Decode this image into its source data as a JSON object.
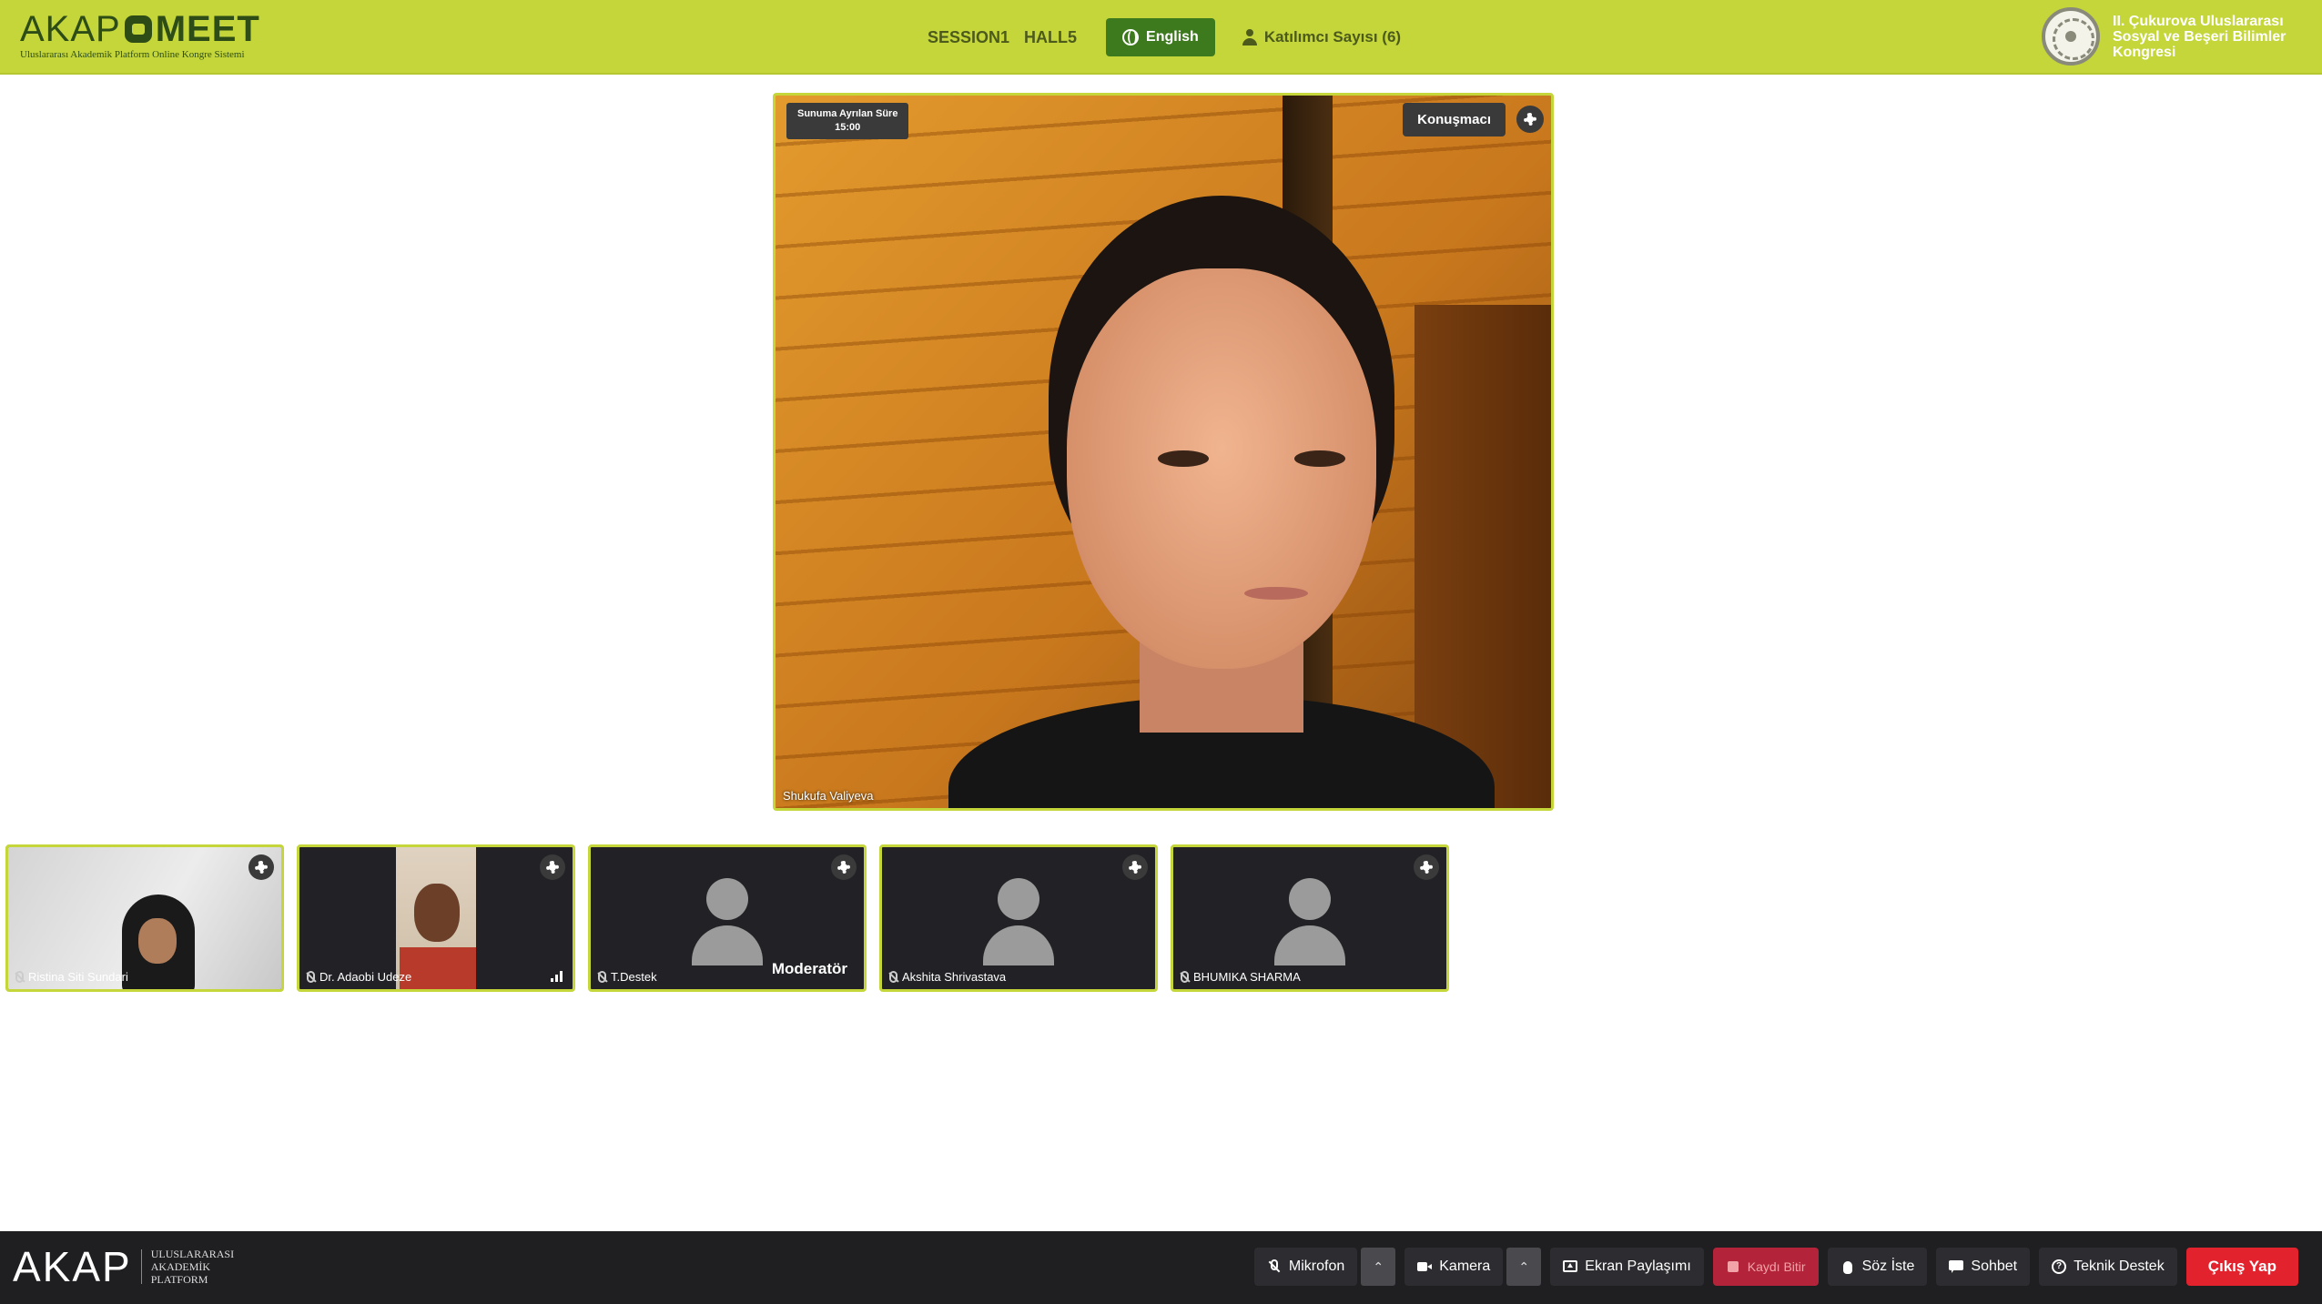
{
  "header": {
    "logo_text_akap": "AKAP",
    "logo_text_meet": "MEET",
    "logo_subtitle": "Uluslararası Akademik Platform Online Kongre Sistemi",
    "session": "SESSION1",
    "hall": "HALL5",
    "language": "English",
    "participant_count": "Katılımcı Sayısı (6)",
    "congress_title": "II. Çukurova Uluslararası Sosyal ve Beşeri Bilimler Kongresi"
  },
  "main_video": {
    "timer_label": "Sunuma Ayrılan Süre",
    "timer_value": "15:00",
    "role_badge": "Konuşmacı",
    "speaker_name": "Shukufa Valiyeva"
  },
  "participants": [
    {
      "name": "Ristina Siti Sundari"
    },
    {
      "name": "Dr. Adaobi Udeze"
    },
    {
      "name": "T.Destek",
      "role": "Moderatör"
    },
    {
      "name": "Akshita Shrivastava"
    },
    {
      "name": "BHUMIKA SHARMA"
    }
  ],
  "footer": {
    "logo_big": "AKAP",
    "logo_line1": "ULUSLARARASI",
    "logo_line2": "AKADEMİK",
    "logo_line3": "PLATFORM",
    "mic": "Mikrofon",
    "camera": "Kamera",
    "screen_share": "Ekran Paylaşımı",
    "stop_record": "Kaydı Bitir",
    "raise_hand": "Söz İste",
    "chat": "Sohbet",
    "support": "Teknik Destek",
    "exit": "Çıkış Yap"
  },
  "colors": {
    "header_bg": "#c4d63a",
    "brand_dark": "#2e4d16",
    "lang_button": "#3d7a1e",
    "exit_button": "#e2232e",
    "record_button": "#b3243a",
    "footer_bg": "#1f1f22"
  },
  "icons": [
    "globe-icon",
    "person-icon",
    "gear-icon",
    "mic-off-icon",
    "camera-icon",
    "screen-share-icon",
    "stop-icon",
    "hand-icon",
    "chat-icon",
    "help-icon",
    "chevron-up-icon",
    "signal-icon"
  ]
}
